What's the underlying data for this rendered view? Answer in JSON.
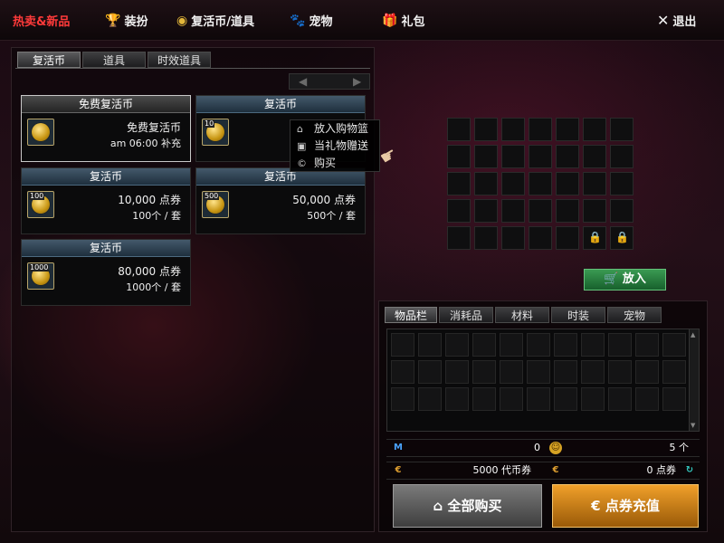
{
  "topbar": {
    "hot_label": "热卖&新品",
    "items": [
      {
        "label": "装扮",
        "icon": "trophy-icon"
      },
      {
        "label": "复活币/道具",
        "icon": "coin-icon"
      },
      {
        "label": "宠物",
        "icon": "paw-icon"
      },
      {
        "label": "礼包",
        "icon": "gift-icon"
      }
    ],
    "exit_label": "退出"
  },
  "left_tabs": [
    "复活币",
    "道具",
    "时效道具"
  ],
  "cards": [
    {
      "title": "免费复活币",
      "line1": "免费复活币",
      "line2": "am 06:00 补充",
      "badge": ""
    },
    {
      "title": "复活币",
      "line1": "",
      "line2": "",
      "badge": "10"
    },
    {
      "title": "复活币",
      "line1": "10,000 点券",
      "line2": "100个 / 套",
      "badge": "100"
    },
    {
      "title": "复活币",
      "line1": "50,000 点券",
      "line2": "500个 / 套",
      "badge": "500"
    },
    {
      "title": "复活币",
      "line1": "80,000 点券",
      "line2": "1000个 / 套",
      "badge": "1000"
    }
  ],
  "context_menu": [
    "放入购物篮",
    "当礼物赠送",
    "购买"
  ],
  "put_button": "放入",
  "inventory_tabs": [
    "物品栏",
    "消耗品",
    "材料",
    "时装",
    "宠物"
  ],
  "currency": {
    "m_value": "0",
    "coin_value": "5 个",
    "token_value": "5000 代币券",
    "points_value": "0 点券"
  },
  "buttons": {
    "buy_all": "全部购买",
    "recharge": "点券充值"
  },
  "colors": {
    "hot": "#ff3a3a",
    "green_button": "#2f8a47",
    "orange_button": "#e0901e"
  }
}
